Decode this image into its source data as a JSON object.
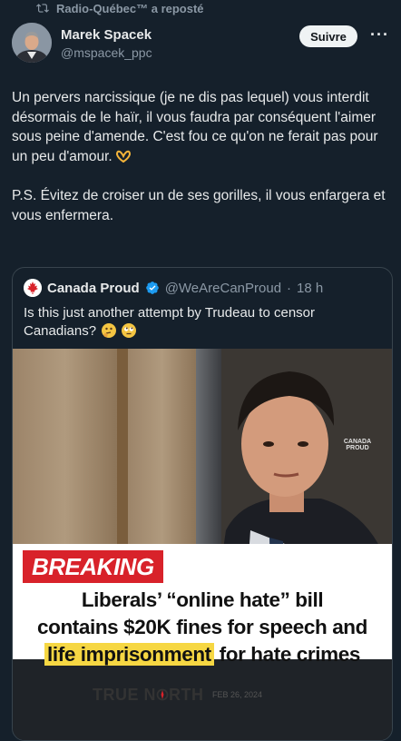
{
  "repost": {
    "label": "Radio-Québec™ a reposté"
  },
  "author": {
    "name": "Marek Spacek",
    "handle": "@mspacek_ppc"
  },
  "actions": {
    "follow_label": "Suivre",
    "more_label": "···"
  },
  "tweet": {
    "paragraph1": "Un pervers narcissique (je ne dis pas lequel) vous interdit désormais de le haïr, il vous faudra par conséquent l'aimer sous peine d'amende. C'est fou ce qu'on ne ferait pas pour un peu d'amour.",
    "paragraph2": "P.S. Évitez de croiser un de ses gorilles, il vous enfargera et vous enfermera."
  },
  "quote": {
    "name": "Canada Proud",
    "handle": "@WeAreCanProud",
    "separator": "·",
    "time": "18 h",
    "text": "Is this just another attempt by Trudeau to censor Canadians?",
    "image": {
      "badge": "BREAKING",
      "headline_line1": "Liberals’ “online hate” bill",
      "headline_line2": "contains $20K fines for speech and",
      "headline_line3_highlight": "life imprisonment",
      "headline_line3_rest": " for hate crimes",
      "logo_left": "TRUE N",
      "logo_right": "RTH",
      "date": "FEB 26, 2024",
      "watermark": "CANADA PROUD"
    }
  },
  "colors": {
    "background": "#15202b",
    "text": "#e7e9ea",
    "muted": "#8b98a5",
    "verified": "#1d9bf0",
    "breaking": "#d8222a",
    "highlight": "#f6d743"
  }
}
